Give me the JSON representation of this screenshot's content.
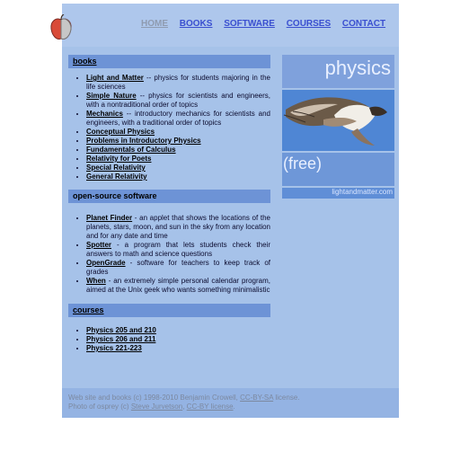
{
  "nav": {
    "home": "HOME",
    "books": "BOOKS",
    "software": "SOFTWARE",
    "courses": "COURSES",
    "contact": "CONTACT"
  },
  "books": {
    "title": "books",
    "items": [
      {
        "link": "Light and Matter",
        "desc": " -- physics for students majoring in the life sciences"
      },
      {
        "link": "Simple Nature",
        "desc": " -- physics for scientists and engineers, with a nontraditional order of topics"
      },
      {
        "link": "Mechanics",
        "desc": " -- introductory mechanics for scientists and engineers, with a traditional order of topics"
      },
      {
        "link": "Conceptual Physics",
        "desc": ""
      },
      {
        "link": "Problems in Introductory Physics",
        "desc": ""
      },
      {
        "link": "Fundamentals of Calculus",
        "desc": ""
      },
      {
        "link": "Relativity for Poets",
        "desc": ""
      },
      {
        "link": "Special Relativity",
        "desc": ""
      },
      {
        "link": "General Relativity",
        "desc": ""
      }
    ]
  },
  "software": {
    "title": "open-source software",
    "items": [
      {
        "link": "Planet Finder",
        "desc": " - an applet that shows the locations of the planets, stars, moon, and sun in the sky from any location and for any date and time"
      },
      {
        "link": "Spotter",
        "desc": " - a program that lets students check their answers to math and science questions"
      },
      {
        "link": "OpenGrade",
        "desc": " - software for teachers to keep track of grades"
      },
      {
        "link": "When",
        "desc": " - an extremely simple personal calendar program, aimed at the Unix geek who wants something minimalistic"
      }
    ]
  },
  "courses": {
    "title": "courses",
    "items": [
      {
        "link": "Physics 205 and 210",
        "desc": ""
      },
      {
        "link": "Physics 206 and 211",
        "desc": ""
      },
      {
        "link": "Physics 221-223",
        "desc": ""
      }
    ]
  },
  "side": {
    "heading": "physics",
    "free": "(free)",
    "credit": "lightandmatter.com"
  },
  "footer": {
    "line1_pre": "Web site and books (c) 1998-2010 Benjamin Crowell,",
    "line1_link": "CC-BY-SA",
    "line1_post": " license.",
    "line2_pre": "Photo of osprey (c)",
    "line2_link1": "Steve Jurvetson",
    "line2_mid": ",",
    "line2_link2": "CC-BY license",
    "line2_post": "."
  }
}
